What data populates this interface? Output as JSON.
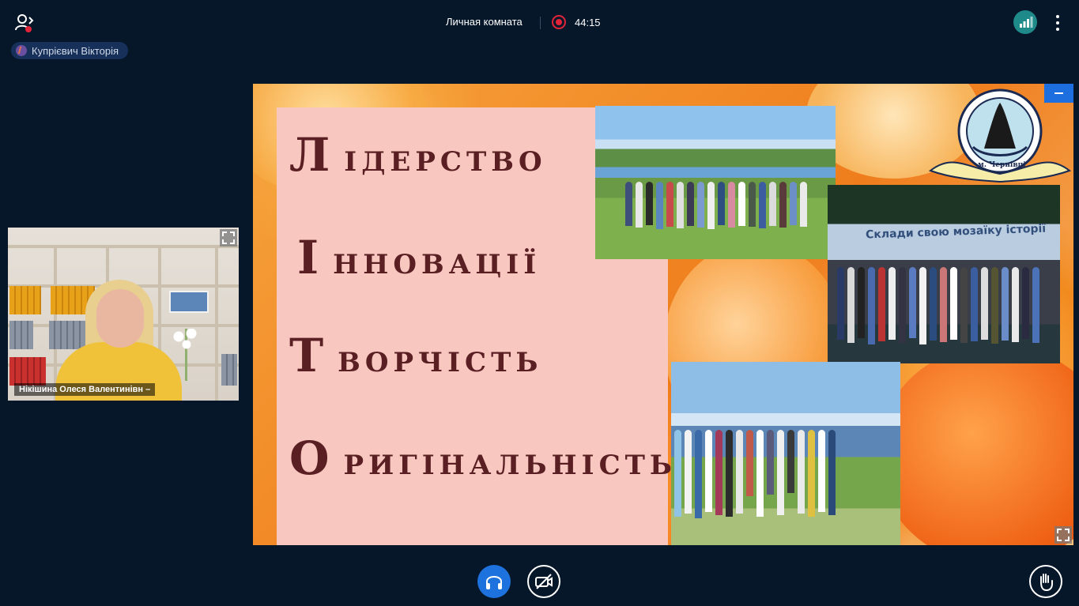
{
  "header": {
    "room_title": "Личная комната",
    "timer": "44:15",
    "user_chip_name": "Купрієвич Вікторія"
  },
  "participant": {
    "name": "Нікішина Олеся Валентинівн –"
  },
  "slide": {
    "words": [
      {
        "initial": "Л",
        "rest": "ІДЕРСТВО"
      },
      {
        "initial": "І",
        "rest": "ННОВАЦІЇ"
      },
      {
        "initial": "Т",
        "rest": "ВОРЧІСТЬ"
      },
      {
        "initial": "О",
        "rest": "РИГІНАЛЬНІСТЬ"
      }
    ],
    "photo2_banner": "Склади свою мозаїку історії",
    "logo_bottom_text": "м. Чернівці"
  },
  "colors": {
    "background": "#06172a",
    "accent": "#1d72de",
    "record": "#e2243a",
    "signal": "#1f8a8a",
    "slide_text": "#5a1f23"
  },
  "icons": {
    "users": "users-icon",
    "record": "record-icon",
    "signal": "signal-bars-icon",
    "more": "more-vertical-icon",
    "expand": "expand-icon",
    "headphones": "headphones-icon",
    "camera_off": "camera-off-icon",
    "raise_hand": "raise-hand-icon",
    "minimize": "minimize-icon"
  }
}
